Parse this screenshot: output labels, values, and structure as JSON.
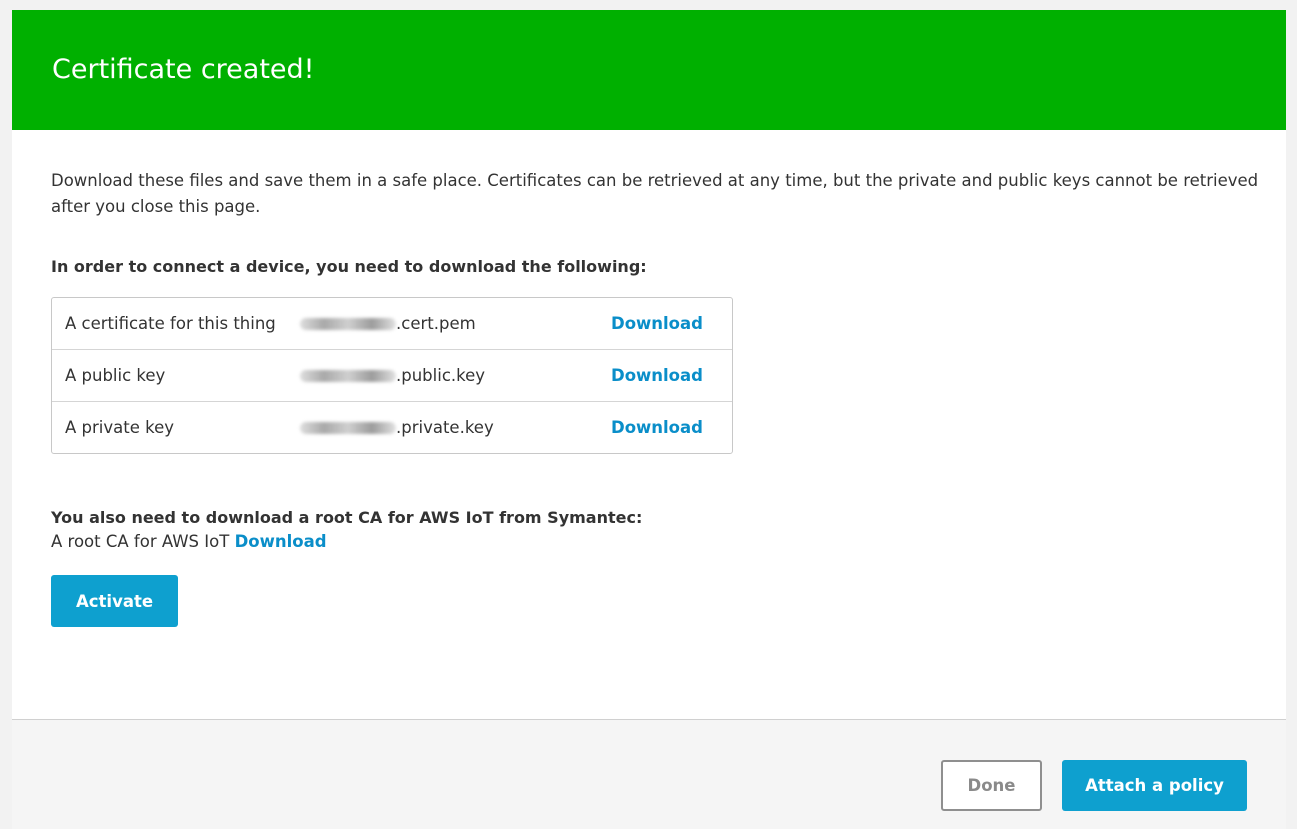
{
  "header": {
    "title": "Certificate created!",
    "color": "#00b000"
  },
  "intro": {
    "text": "Download these files and save them in a safe place. Certificates can be retrieved at any time, but the private and public keys cannot be retrieved after you close this page."
  },
  "files_section": {
    "title": "In order to connect a device, you need to download the following:",
    "rows": [
      {
        "description": "A certificate for this thing",
        "file_suffix": ".cert.pem",
        "link": "Download"
      },
      {
        "description": "A public key",
        "file_suffix": ".public.key",
        "link": "Download"
      },
      {
        "description": "A private key",
        "file_suffix": ".private.key",
        "link": "Download"
      }
    ]
  },
  "root_ca_section": {
    "title": "You also need to download a root CA for AWS IoT from Symantec:",
    "label": "A root CA for AWS IoT",
    "link": "Download"
  },
  "buttons": {
    "activate": "Activate",
    "done": "Done",
    "attach_policy": "Attach a policy"
  },
  "colors": {
    "accent": "#0ea0cf",
    "link": "#0a8ec9"
  }
}
